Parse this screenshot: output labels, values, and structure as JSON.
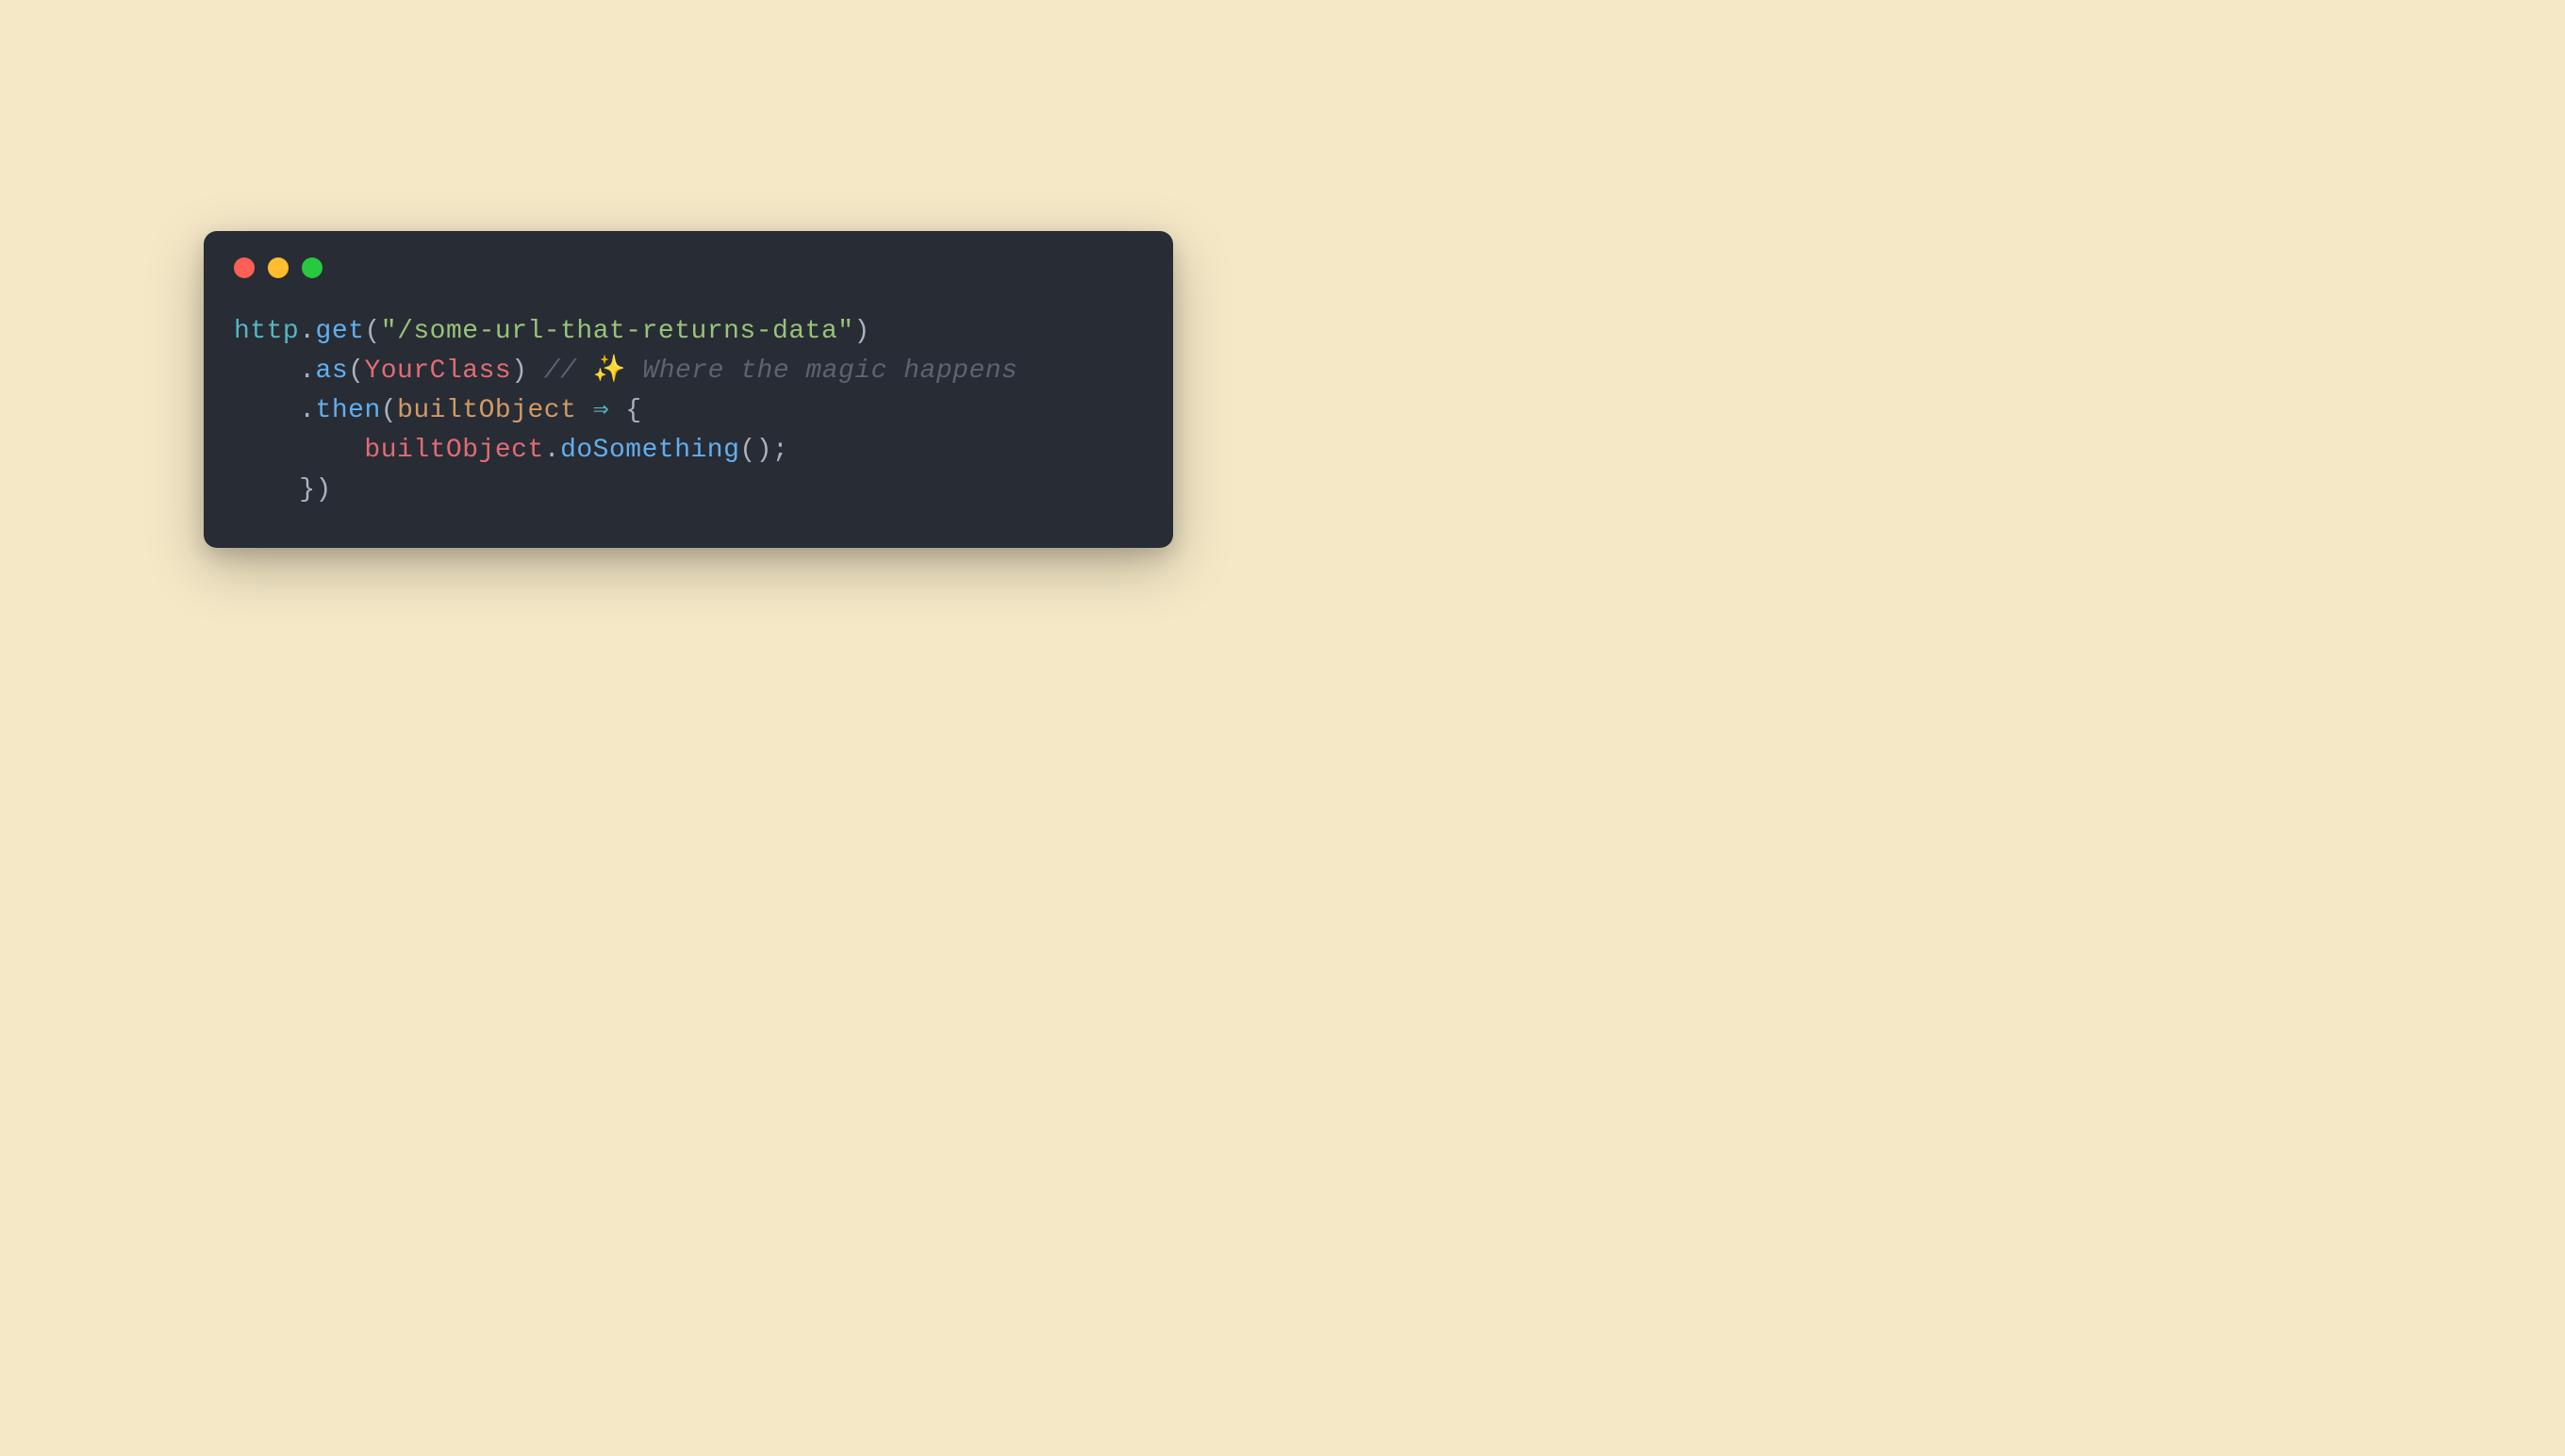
{
  "code": {
    "line1": {
      "http": "http",
      "dot1": ".",
      "get": "get",
      "paren1": "(",
      "url": "\"/some-url-that-returns-data\"",
      "paren2": ")"
    },
    "line2": {
      "indent": "    ",
      "dot": ".",
      "as": "as",
      "paren1": "(",
      "class": "YourClass",
      "paren2": ") ",
      "comment_slash": "// ",
      "sparkle": "✨",
      "comment_text": " Where the magic happens"
    },
    "line3": {
      "indent": "    ",
      "dot": ".",
      "then": "then",
      "paren1": "(",
      "param": "builtObject",
      "arrow": " ⇒ ",
      "brace": "{"
    },
    "line4": {
      "indent": "        ",
      "obj": "builtObject",
      "dot": ".",
      "method": "doSomething",
      "paren": "();"
    },
    "line5": {
      "indent": "    ",
      "brace": "})"
    }
  }
}
